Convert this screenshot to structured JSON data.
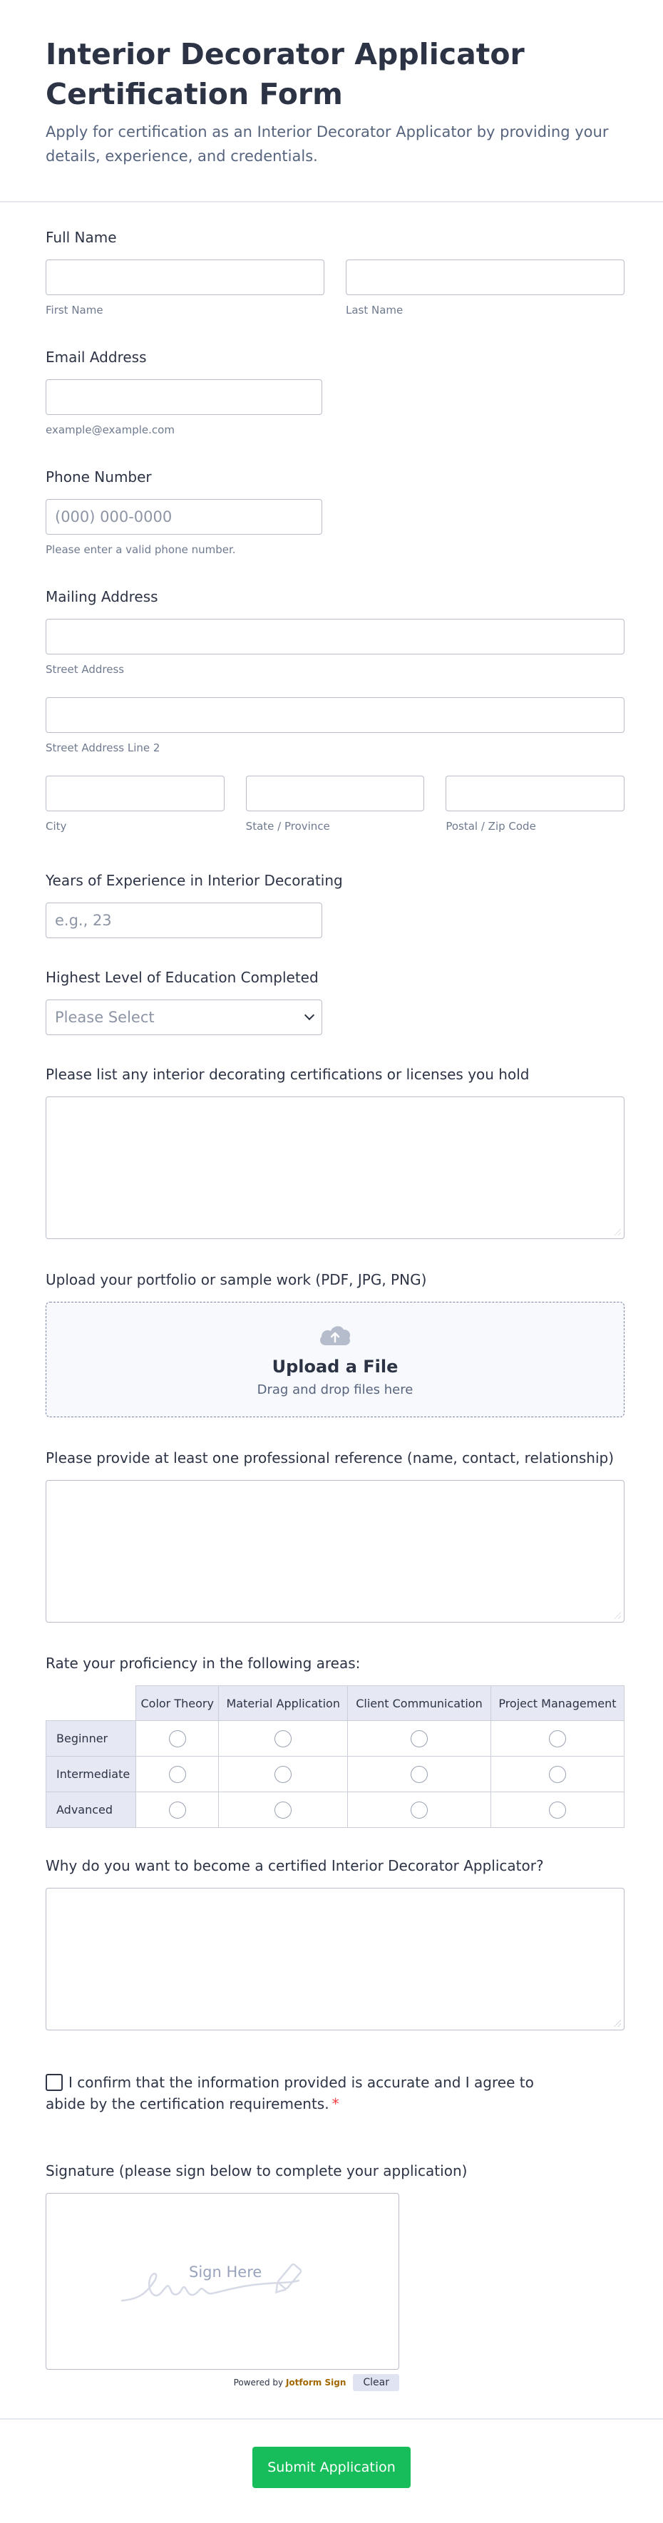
{
  "header": {
    "title": "Interior Decorator Applicator Certification Form",
    "subtitle": "Apply for certification as an Interior Decorator Applicator by providing your details, experience, and credentials."
  },
  "full_name": {
    "label": "Full Name",
    "first_sub": "First Name",
    "last_sub": "Last Name",
    "first_value": "",
    "last_value": ""
  },
  "email": {
    "label": "Email Address",
    "sub": "example@example.com",
    "value": ""
  },
  "phone": {
    "label": "Phone Number",
    "placeholder": "(000) 000-0000",
    "sub": "Please enter a valid phone number."
  },
  "address": {
    "label": "Mailing Address",
    "street_sub": "Street Address",
    "street2_sub": "Street Address Line 2",
    "city_sub": "City",
    "state_sub": "State / Province",
    "zip_sub": "Postal / Zip Code"
  },
  "experience": {
    "label": "Years of Experience in Interior Decorating",
    "placeholder": "e.g., 23"
  },
  "education": {
    "label": "Highest Level of Education Completed",
    "selected": "Please Select"
  },
  "certifications": {
    "label": "Please list any interior decorating certifications or licenses you hold"
  },
  "portfolio": {
    "label": "Upload your portfolio or sample work (PDF, JPG, PNG)",
    "button": "Upload a File",
    "hint": "Drag and drop files here"
  },
  "reference": {
    "label": "Please provide at least one professional reference (name, contact, relationship)"
  },
  "proficiency": {
    "label": "Rate your proficiency in the following areas:",
    "columns": [
      "Color Theory",
      "Material Application",
      "Client Communication",
      "Project Management"
    ],
    "rows": [
      "Beginner",
      "Intermediate",
      "Advanced"
    ]
  },
  "motivation": {
    "label": "Why do you want to become a certified Interior Decorator Applicator?"
  },
  "confirm": {
    "text": "I confirm that the information provided is accurate and I agree to abide by the certification requirements.",
    "required_mark": "*"
  },
  "signature": {
    "label": "Signature (please sign below to complete your application)",
    "placeholder": "Sign Here",
    "powered_prefix": "Powered by",
    "powered_brand": "Jotform Sign",
    "clear": "Clear"
  },
  "submit": {
    "label": "Submit Application"
  },
  "colors": {
    "submit": "#18bd5b",
    "text": "#2c3345",
    "required": "#f23a3c"
  }
}
